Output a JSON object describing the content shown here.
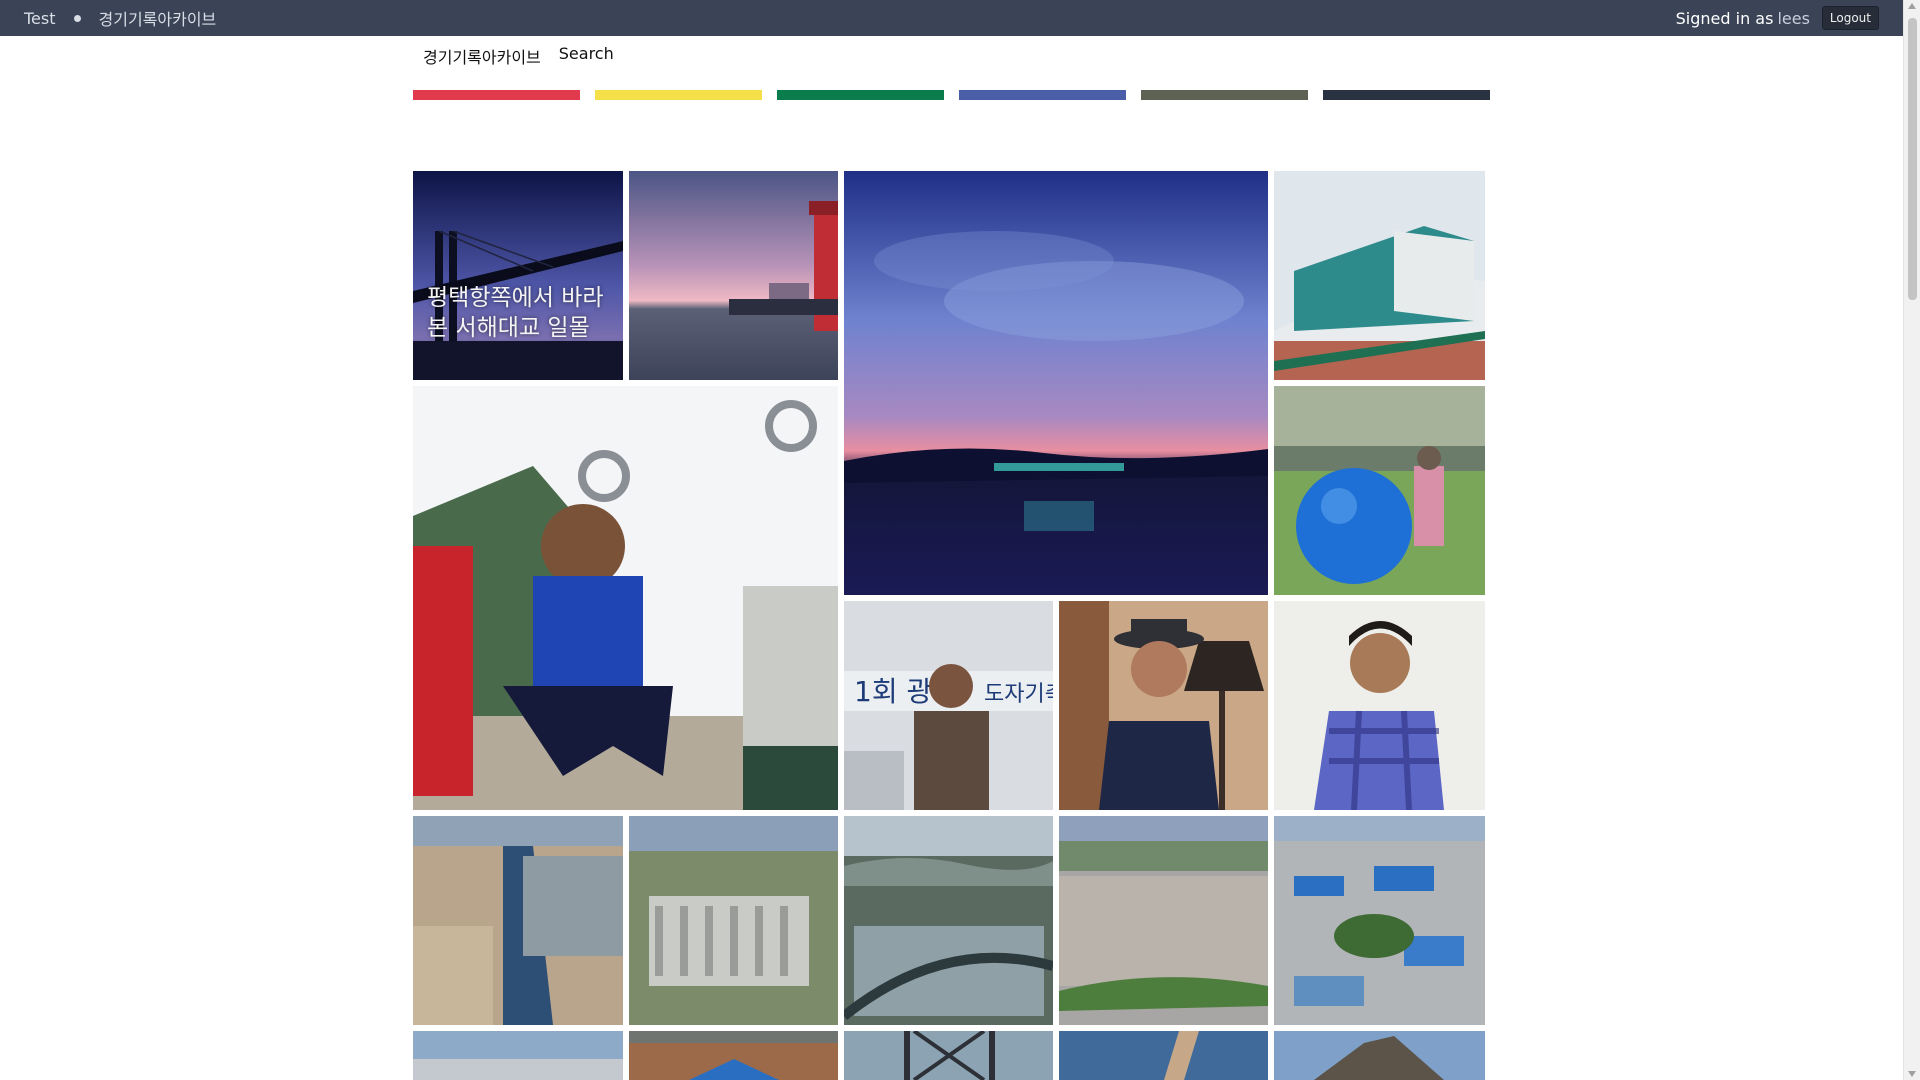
{
  "topbar": {
    "site": "Test",
    "archive": "경기기록아카이브",
    "signed_in_label": "Signed in as",
    "username": "lees",
    "logout_label": "Logout"
  },
  "subnav": {
    "home": "경기기록아카이브",
    "search": "Search"
  },
  "color_bars": [
    "#e23a4d",
    "#f6e04a",
    "#0b7d4c",
    "#4b5ea8",
    "#5d6253",
    "#283241"
  ],
  "gallery": {
    "tiles": [
      {
        "caption": "평택항쪽에서 바라본 서해대교 일몰",
        "subject": "bridge-sunset"
      },
      {
        "caption": "",
        "subject": "lighthouse-pier-dusk"
      },
      {
        "caption": "",
        "subject": "lake-twilight-sky"
      },
      {
        "caption": "",
        "subject": "modern-glass-building"
      },
      {
        "caption": "",
        "subject": "children-on-gymnastic-rings"
      },
      {
        "caption": "",
        "subject": "woman-with-blue-ball"
      },
      {
        "caption": "",
        "subject": "man-at-ceramic-festival"
      },
      {
        "caption": "",
        "subject": "man-in-fedora-hat"
      },
      {
        "caption": "",
        "subject": "man-in-plaid-shirt"
      },
      {
        "caption": "",
        "subject": "aerial-river-estuary"
      },
      {
        "caption": "",
        "subject": "aerial-apartment-city"
      },
      {
        "caption": "",
        "subject": "aerial-greenhouse-valley"
      },
      {
        "caption": "",
        "subject": "aerial-dense-town"
      },
      {
        "caption": "",
        "subject": "aerial-industrial-blue-roofs"
      },
      {
        "caption": "",
        "subject": "aerial-city-coast"
      },
      {
        "caption": "",
        "subject": "blue-pavilion-hill"
      },
      {
        "caption": "",
        "subject": "bridge-steel-frame"
      },
      {
        "caption": "",
        "subject": "sea-pier-walkway"
      },
      {
        "caption": "",
        "subject": "rocky-peak-sky"
      }
    ]
  }
}
